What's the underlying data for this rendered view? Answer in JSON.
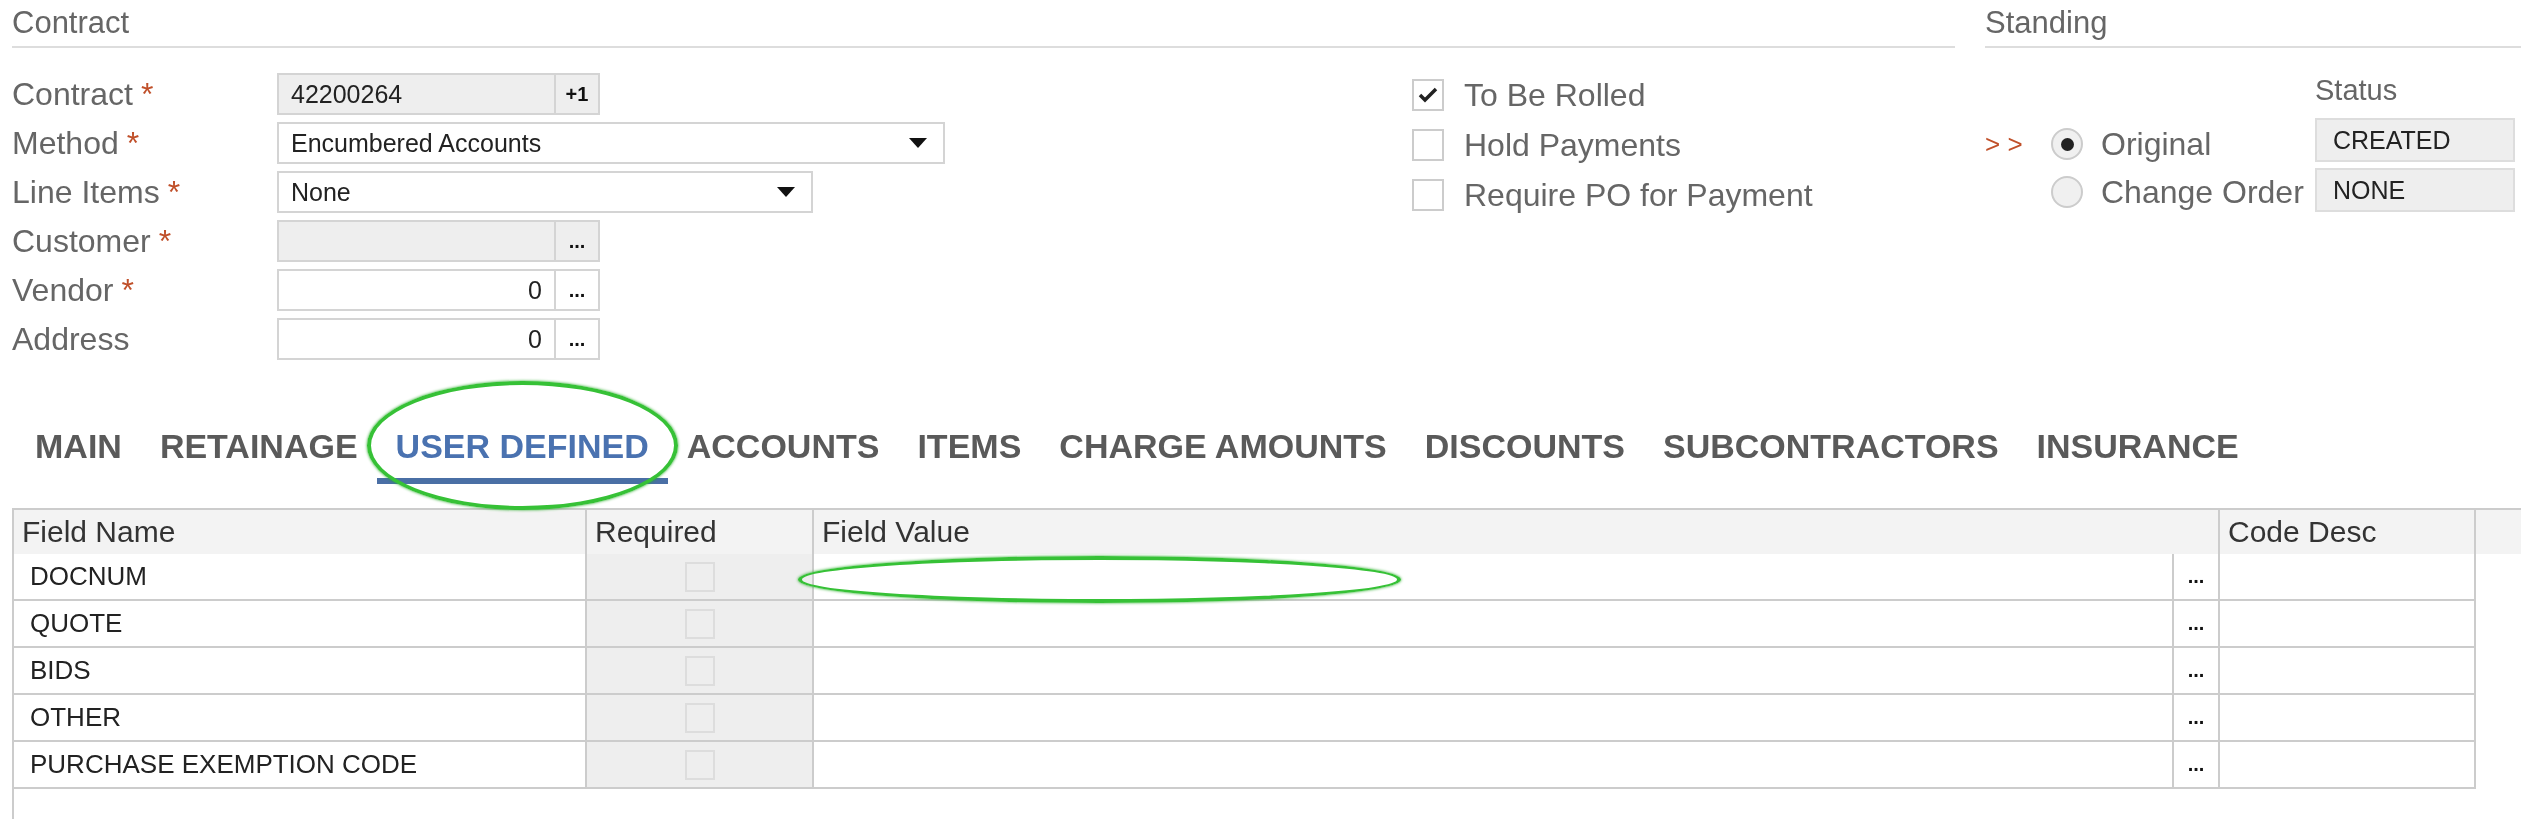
{
  "contract": {
    "title": "Contract",
    "fields": [
      {
        "label": "Contract",
        "marker": "*",
        "kind": "counter",
        "value": "42200264",
        "button": "+1"
      },
      {
        "label": "Method",
        "marker": "*",
        "kind": "dropdown",
        "value": "Encumbered Accounts"
      },
      {
        "label": "Line Items",
        "marker": "*",
        "kind": "dropdown",
        "value": "None"
      },
      {
        "label": "Customer",
        "marker": "*",
        "kind": "lookup",
        "disabled": true,
        "button": "..."
      },
      {
        "label": "Vendor",
        "marker": "*",
        "kind": "lookup",
        "disabled": false,
        "value": "0",
        "button": "..."
      },
      {
        "label": "Address",
        "kind": "lookup",
        "disabled": false,
        "value": "0",
        "button": "..."
      }
    ],
    "options": [
      {
        "label": "To Be Rolled",
        "checked": true
      },
      {
        "label": "Hold Payments",
        "checked": false
      },
      {
        "label": "Require PO for Payment",
        "checked": false
      }
    ]
  },
  "standing": {
    "title": "Standing",
    "pointer": "> >",
    "options": [
      {
        "label": "Original",
        "selected": true
      },
      {
        "label": "Change Order",
        "selected": false
      }
    ],
    "status": {
      "label": "Status",
      "values": [
        "CREATED",
        "NONE"
      ]
    }
  },
  "tabs": [
    {
      "label": "MAIN",
      "selected": false,
      "circled": false
    },
    {
      "label": "RETAINAGE",
      "selected": false,
      "circled": false
    },
    {
      "label": "USER DEFINED",
      "selected": true,
      "circled": true
    },
    {
      "label": "ACCOUNTS",
      "selected": false,
      "circled": false
    },
    {
      "label": "ITEMS",
      "selected": false,
      "circled": false
    },
    {
      "label": "CHARGE AMOUNTS",
      "selected": false,
      "circled": false
    },
    {
      "label": "DISCOUNTS",
      "selected": false,
      "circled": false
    },
    {
      "label": "SUBCONTRACTORS",
      "selected": false,
      "circled": false
    },
    {
      "label": "INSURANCE",
      "selected": false,
      "circled": false
    }
  ],
  "table": {
    "columns": [
      "Field Name",
      "Required",
      "Field Value",
      "Code Desc"
    ],
    "rows": [
      {
        "field_name": "DOCNUM",
        "required": false,
        "lookup": "...",
        "value_circled": true
      },
      {
        "field_name": "QUOTE",
        "required": false,
        "lookup": "...",
        "value_circled": false
      },
      {
        "field_name": "BIDS",
        "required": false,
        "lookup": "...",
        "value_circled": false
      },
      {
        "field_name": "OTHER",
        "required": false,
        "lookup": "...",
        "value_circled": false
      },
      {
        "field_name": "PURCHASE EXEMPTION CODE",
        "required": false,
        "lookup": "...",
        "value_circled": false
      }
    ]
  }
}
